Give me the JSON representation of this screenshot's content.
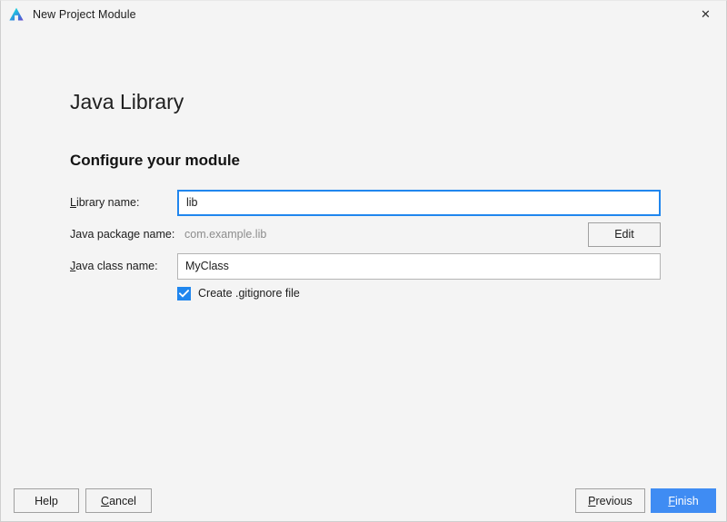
{
  "window": {
    "title": "New Project Module",
    "logo_icon": "android-studio-logo-icon",
    "close_icon": "close-icon",
    "close_glyph": "✕"
  },
  "content": {
    "step_title": "Java Library",
    "section_heading": "Configure your module"
  },
  "form": {
    "library_name": {
      "label_prefix": "",
      "label_mnemonic": "L",
      "label_suffix": "ibrary name:",
      "label_full": "Library name:",
      "value": "lib",
      "placeholder": "",
      "focused": true
    },
    "package_name": {
      "label_full": "Java package name:",
      "value": "com.example.lib",
      "edit_button_label": "Edit",
      "editable": false
    },
    "class_name": {
      "label_prefix": "",
      "label_mnemonic": "J",
      "label_suffix": "ava class name:",
      "label_full": "Java class name:",
      "value": "MyClass",
      "placeholder": "",
      "focused": false
    },
    "gitignore_checkbox": {
      "label": "Create .gitignore file",
      "checked": true,
      "check_icon": "checkmark-icon"
    }
  },
  "footer": {
    "help_label": "Help",
    "cancel_mnemonic": "C",
    "cancel_suffix": "ancel",
    "cancel_label": "Cancel",
    "previous_mnemonic": "P",
    "previous_suffix": "revious",
    "previous_label": "Previous",
    "finish_mnemonic": "F",
    "finish_suffix": "inish",
    "finish_label": "Finish"
  },
  "colors": {
    "accent_blue": "#3f8cf3",
    "focus_border_blue": "#2086ee",
    "checkbox_blue": "#2086ee",
    "window_bg": "#f4f4f4",
    "input_bg": "#ffffff",
    "text": "#1c1c1c",
    "disabled_text": "#8d8d8d"
  }
}
